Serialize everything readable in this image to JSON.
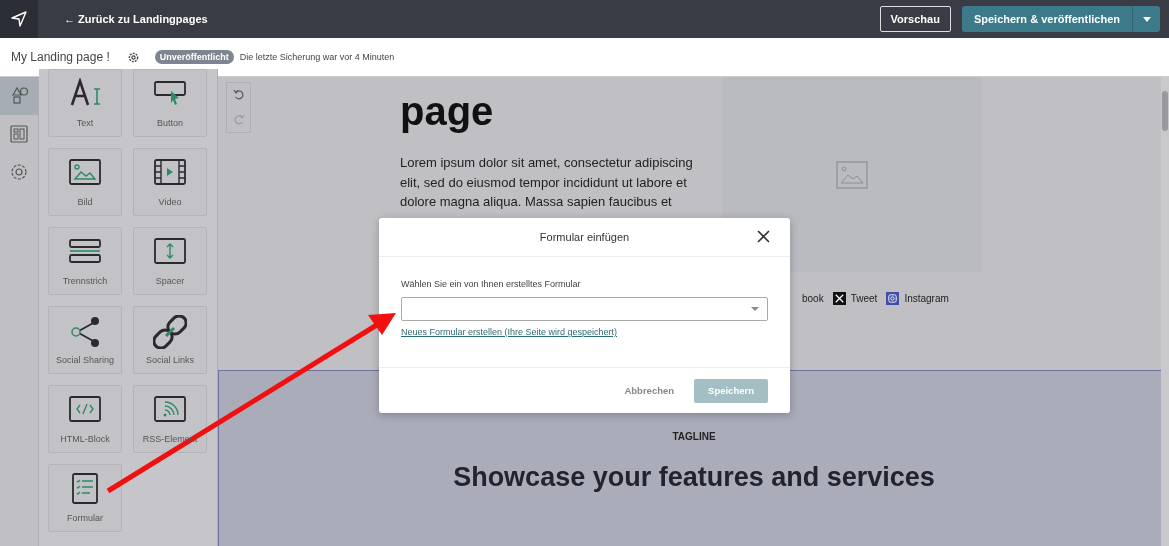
{
  "app_bar": {
    "back_link": "← Zurück zu Landingpages",
    "preview_button": "Vorschau",
    "publish_button": "Speichern & veröffentlichen"
  },
  "page_bar": {
    "title": "My Landing page !",
    "status_badge": "Unveröffentlicht",
    "save_info": "Die letzte Sicherung war vor 4 Minuten"
  },
  "rail": [
    {
      "kind": "shapes",
      "selected": true
    },
    {
      "kind": "layout",
      "selected": false
    },
    {
      "kind": "settings",
      "selected": false
    }
  ],
  "elements": [
    {
      "kind": "text",
      "label": "Text"
    },
    {
      "kind": "button",
      "label": "Button"
    },
    {
      "kind": "image",
      "label": "Bild"
    },
    {
      "kind": "video",
      "label": "Video"
    },
    {
      "kind": "divider",
      "label": "Trennstrich"
    },
    {
      "kind": "spacer",
      "label": "Spacer"
    },
    {
      "kind": "share",
      "label": "Social Sharing"
    },
    {
      "kind": "links",
      "label": "Social Links"
    },
    {
      "kind": "html",
      "label": "HTML-Block"
    },
    {
      "kind": "rss",
      "label": "RSS-Element"
    },
    {
      "kind": "form",
      "label": "Formular"
    }
  ],
  "canvas": {
    "heading": "page",
    "paragraph": "Lorem ipsum dolor sit amet, consectetur adipiscing elit, sed do eiusmod tempor incididunt ut labore et dolore magna aliqua. Massa sapien faucibus et",
    "social_links": [
      {
        "kind": "facebook",
        "label": "book"
      },
      {
        "kind": "x",
        "label": "Tweet"
      },
      {
        "kind": "instagram",
        "label": "Instagram"
      }
    ],
    "tagline": "TAGLINE",
    "section_heading": "Showcase your features and services"
  },
  "dialog": {
    "title": "Formular einfügen",
    "field_label": "Wählen Sie ein von Ihnen erstelltes Formular",
    "create_link": "Neues Formular erstellen (Ihre Seite wird gespeichert)",
    "cancel_button": "Abbrechen",
    "save_button": "Speichern",
    "save_disabled": true
  }
}
